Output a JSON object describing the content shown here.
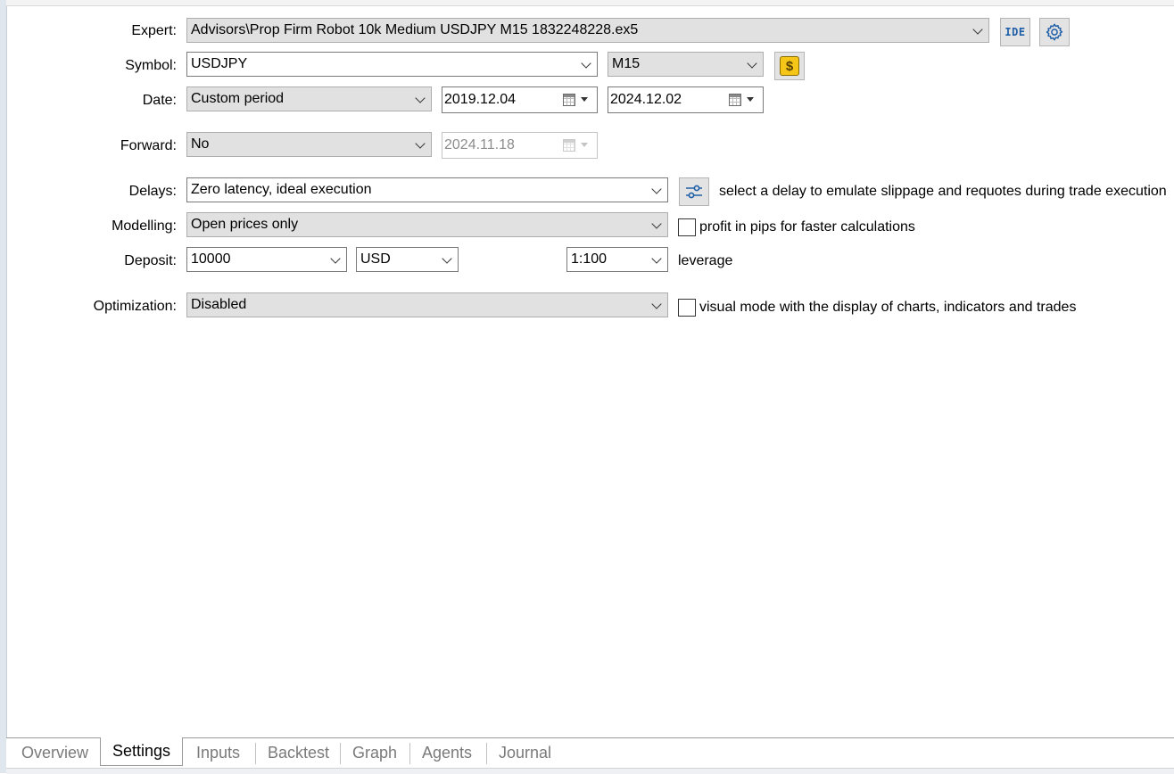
{
  "labels": {
    "expert": "Expert:",
    "symbol": "Symbol:",
    "date": "Date:",
    "forward": "Forward:",
    "delays": "Delays:",
    "modelling": "Modelling:",
    "deposit": "Deposit:",
    "optimization": "Optimization:"
  },
  "expert": {
    "value": "Advisors\\Prop Firm Robot 10k Medium USDJPY M15 1832248228.ex5",
    "ide_label": "IDE"
  },
  "symbol": {
    "value": "USDJPY",
    "timeframe": "M15",
    "currency_icon": "$"
  },
  "date": {
    "period": "Custom period",
    "from": "2019.12.04",
    "to": "2024.12.02"
  },
  "forward": {
    "value": "No",
    "date": "2024.11.18"
  },
  "delays": {
    "value": "Zero latency, ideal execution",
    "note": "select a delay to emulate slippage and requotes during trade execution"
  },
  "modelling": {
    "value": "Open prices only",
    "pips_label": "profit in pips for faster calculations",
    "pips_checked": false
  },
  "deposit": {
    "amount": "10000",
    "currency": "USD",
    "leverage": "1:100",
    "leverage_label": "leverage"
  },
  "optimization": {
    "value": "Disabled",
    "visual_label": "visual mode with the display of charts, indicators and trades",
    "visual_checked": false
  },
  "tabs": [
    {
      "label": "Overview",
      "active": false
    },
    {
      "label": "Settings",
      "active": true
    },
    {
      "label": "Inputs",
      "active": false
    },
    {
      "label": "Backtest",
      "active": false
    },
    {
      "label": "Graph",
      "active": false
    },
    {
      "label": "Agents",
      "active": false
    },
    {
      "label": "Journal",
      "active": false
    }
  ],
  "colors": {
    "accent_icon": "#1f5fa8",
    "currency_icon_bg": "#f5c518",
    "combo_bg": "#e1e1e1"
  }
}
